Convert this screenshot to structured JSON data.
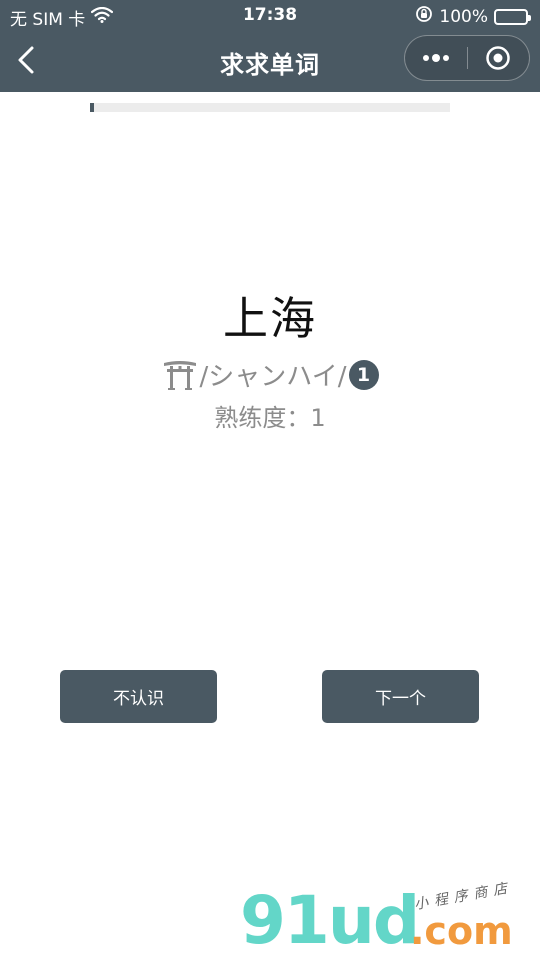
{
  "status_bar": {
    "carrier": "无 SIM 卡",
    "time": "17:38",
    "battery_percent": "100%"
  },
  "nav": {
    "title": "求求单词"
  },
  "progress": {
    "fraction": 0.01
  },
  "card": {
    "word": "上海",
    "reading": "/シャンハイ/",
    "reading_icon": "torii-icon",
    "badge": "1",
    "proficiency": "熟练度：1"
  },
  "buttons": {
    "unknown_label": "不认识",
    "next_label": "下一个"
  },
  "watermark": {
    "logo": "91ud",
    "suffix": ".com",
    "tagline": "小程序商店"
  },
  "colors": {
    "primary": "#4a5963",
    "battery": "#4cd964",
    "muted_text": "#8c8c8c"
  }
}
